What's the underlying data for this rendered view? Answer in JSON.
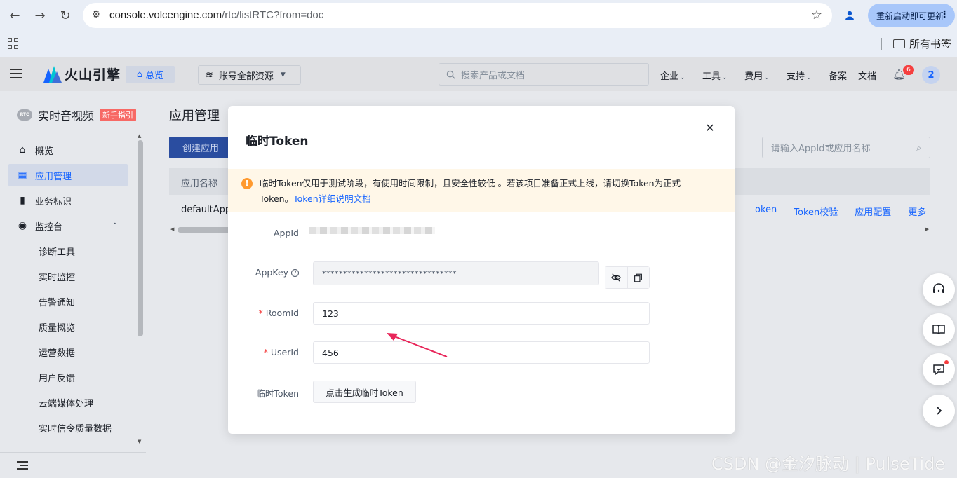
{
  "browser": {
    "url_host": "console.volcengine.com",
    "url_path": "/rtc/listRTC?from=doc",
    "update_label": "重新启动即可更新",
    "bookmarks_folder": "所有书签"
  },
  "topnav": {
    "brand": "火山引擎",
    "home": "总览",
    "resources": "账号全部资源",
    "search_placeholder": "搜索产品或文档",
    "menus": [
      "企业",
      "工具",
      "费用",
      "支持",
      "备案",
      "文档"
    ],
    "notifications": "6",
    "user_initial": "2"
  },
  "sidebar": {
    "title": "实时音视频",
    "rtc_badge": "RTC",
    "guide_tag": "新手指引",
    "items": [
      {
        "label": "概览"
      },
      {
        "label": "应用管理"
      },
      {
        "label": "业务标识"
      },
      {
        "label": "监控台"
      }
    ],
    "sub_items": [
      "诊断工具",
      "实时监控",
      "告警通知",
      "质量概览",
      "运营数据",
      "用户反馈",
      "云端媒体处理",
      "实时信令质量数据"
    ]
  },
  "main": {
    "title": "应用管理",
    "create_button": "创建应用",
    "search_placeholder": "请输入AppId或应用名称",
    "table": {
      "header_name": "应用名称",
      "row_name": "defaultAppN",
      "actions": [
        "oken",
        "Token校验",
        "应用配置",
        "更多"
      ]
    }
  },
  "modal": {
    "title": "临时Token",
    "alert_text": "临时Token仅用于测试阶段，有使用时间限制，且安全性较低 。若该项目准备正式上线，请切换Token为正式Token。",
    "alert_link": "Token详细说明文档",
    "labels": {
      "appid": "AppId",
      "appkey": "AppKey",
      "roomid": "RoomId",
      "userid": "UserId",
      "token": "临时Token"
    },
    "appkey_masked": "********************************",
    "roomid_value": "123",
    "userid_value": "456",
    "generate_button": "点击生成临时Token"
  },
  "watermark": "CSDN @金汐脉动 | PulseTide",
  "colors": {
    "accent": "#1664ff",
    "warning_bg": "#fff7e8",
    "warning_icon": "#ff9a2e",
    "annotation_arrow": "#e8265a"
  }
}
